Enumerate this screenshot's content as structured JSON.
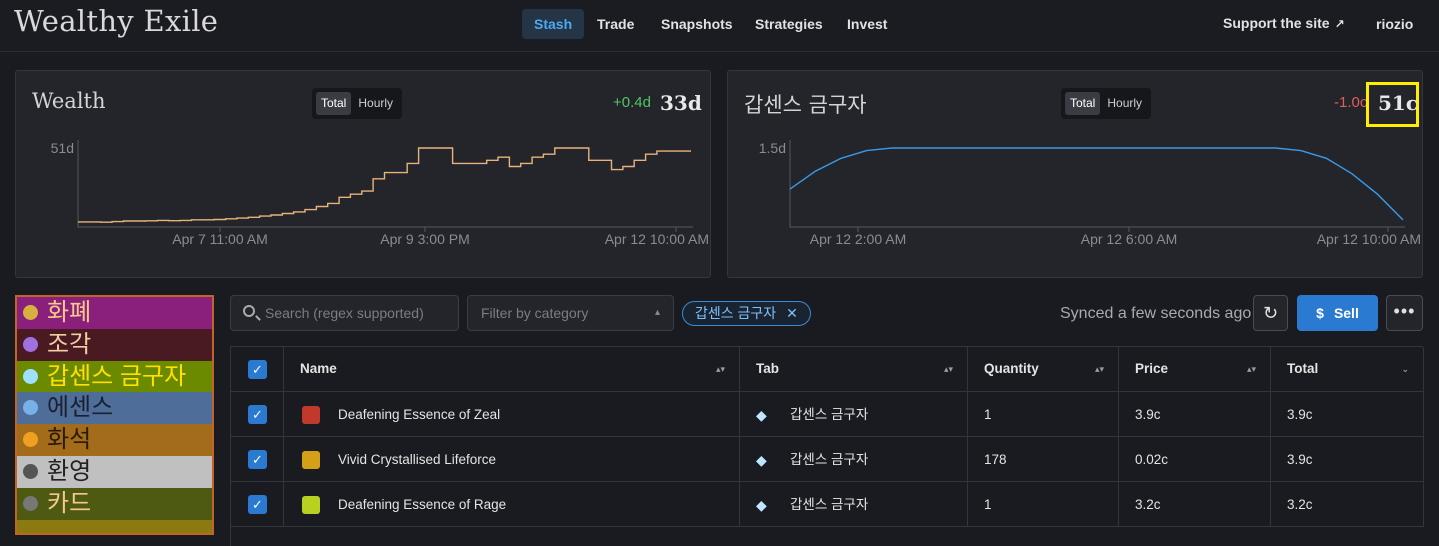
{
  "header": {
    "logo": "Wealthy Exile",
    "nav": [
      {
        "label": "Stash",
        "active": true
      },
      {
        "label": "Trade",
        "active": false
      },
      {
        "label": "Snapshots",
        "active": false
      },
      {
        "label": "Strategies",
        "active": false
      },
      {
        "label": "Invest",
        "active": false
      }
    ],
    "support_label": "Support the site",
    "user": "riozio"
  },
  "wealth_card": {
    "title": "Wealth",
    "toggle": {
      "total": "Total",
      "hourly": "Hourly",
      "selected": "Total"
    },
    "delta": "+0.4d",
    "delta_color": "#4cc764",
    "value": "33d",
    "chart_data": {
      "type": "line",
      "y_tick": "51d",
      "x_ticks": [
        "Apr 7 11:00 AM",
        "Apr 9 3:00 PM",
        "Apr 12 10:00 AM"
      ],
      "series": [
        {
          "color": "#e8b37a",
          "values": [
            2,
            2,
            1.8,
            2.2,
            2.6,
            2.6,
            2.7,
            3,
            2.8,
            3,
            3.4,
            3.4,
            3.6,
            4,
            4.5,
            5,
            5.8,
            6.5,
            7.5,
            8.5,
            10,
            12,
            14,
            18,
            20,
            22,
            30,
            34,
            34,
            40,
            50,
            50,
            50,
            40,
            40,
            40,
            42,
            44,
            38,
            40,
            44,
            46,
            50,
            50,
            50,
            42,
            42,
            36,
            38,
            42,
            46,
            48,
            48,
            48,
            48
          ]
        }
      ]
    }
  },
  "tab_card": {
    "title": "갑센스 금구자",
    "toggle": {
      "total": "Total",
      "hourly": "Hourly",
      "selected": "Total"
    },
    "delta": "-1.0c",
    "delta_color": "#e05d5d",
    "value": "51c",
    "chart_data": {
      "type": "line",
      "y_tick": "1.5d",
      "x_ticks": [
        "Apr 12 2:00 AM",
        "Apr 12 6:00 AM",
        "Apr 12 10:00 AM"
      ],
      "series": [
        {
          "color": "#3a9ae8",
          "values": [
            0.7,
            1.05,
            1.3,
            1.45,
            1.5,
            1.5,
            1.5,
            1.5,
            1.5,
            1.5,
            1.5,
            1.5,
            1.5,
            1.5,
            1.5,
            1.5,
            1.5,
            1.5,
            1.5,
            1.5,
            1.45,
            1.3,
            1.0,
            0.6,
            0.1
          ]
        }
      ]
    }
  },
  "sidebar": {
    "items": [
      {
        "label": "화폐",
        "bg": "#8b1f7c",
        "color": "#f4c98a",
        "icon": "#d8b040"
      },
      {
        "label": "조각",
        "bg": "#4a1a22",
        "color": "#f0d0a0",
        "icon": "#a070e0"
      },
      {
        "label": "갑센스 금구자",
        "bg": "#6b8a00",
        "color": "#ffe000",
        "icon": "#a0e0ff"
      },
      {
        "label": "에센스",
        "bg": "#4e6d98",
        "color": "#1a2030",
        "icon": "#7ab0e8"
      },
      {
        "label": "화석",
        "bg": "#a26c1a",
        "color": "#2a1a08",
        "icon": "#f0a020"
      },
      {
        "label": "환영",
        "bg": "#c0c0c0",
        "color": "#222222",
        "icon": "#555555"
      },
      {
        "label": "카드",
        "bg": "#4e5a12",
        "color": "#f4c98a",
        "icon": "#777777"
      },
      {
        "label": "",
        "bg": "#8a7a10",
        "color": "#2a2a08",
        "icon": "#8a7a10"
      }
    ]
  },
  "toolbar": {
    "search_placeholder": "Search (regex supported)",
    "filter_placeholder": "Filter by category",
    "chip_label": "갑센스 금구자",
    "synced": "Synced a few seconds ago",
    "sell_label": "Sell"
  },
  "table": {
    "columns": [
      "Name",
      "Tab",
      "Quantity",
      "Price",
      "Total"
    ],
    "rows": [
      {
        "name": "Deafening Essence of Zeal",
        "tab": "갑센스 금구자",
        "quantity": "1",
        "price": "3.9c",
        "total": "3.9c",
        "icon": "#c0392b"
      },
      {
        "name": "Vivid Crystallised Lifeforce",
        "tab": "갑센스 금구자",
        "quantity": "178",
        "price": "0.02c",
        "total": "3.9c",
        "icon": "#d4a017"
      },
      {
        "name": "Deafening Essence of Rage",
        "tab": "갑센스 금구자",
        "quantity": "1",
        "price": "3.2c",
        "total": "3.2c",
        "icon": "#b8d020"
      }
    ]
  }
}
